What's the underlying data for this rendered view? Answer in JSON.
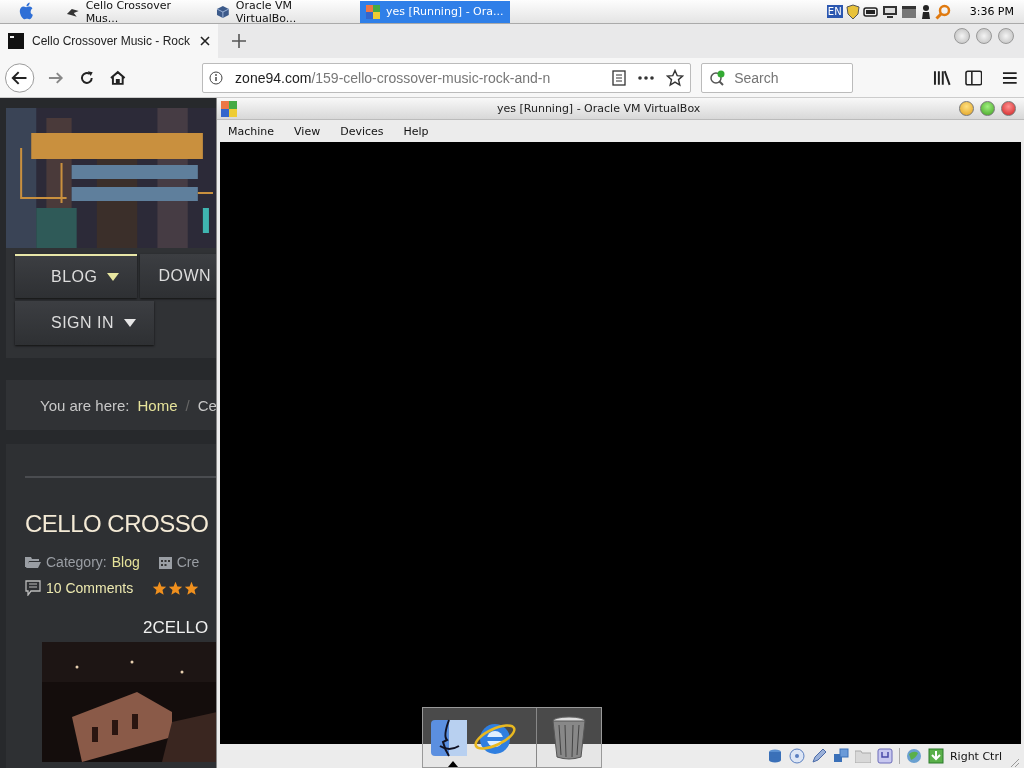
{
  "taskbar": {
    "tasks": [
      {
        "title": "Cello Crossover Mus...",
        "selected": false
      },
      {
        "title": "Oracle VM VirtualBo...",
        "selected": false
      },
      {
        "title": "yes [Running] - Ora...",
        "selected": true
      }
    ],
    "keyboard_layout": "EN",
    "clock": "3:36 PM"
  },
  "browser": {
    "tab": {
      "title": "Cello Crossover Music - Rock"
    },
    "address": {
      "domain": "zone94.com",
      "path": "/159-cello-crossover-music-rock-and-n"
    },
    "search": {
      "placeholder": "Search"
    }
  },
  "page": {
    "nav": [
      {
        "label": "BLOG",
        "selected": true,
        "has_menu": true
      },
      {
        "label": "DOWN",
        "selected": false,
        "has_menu": false
      },
      {
        "label": "SIGN IN",
        "selected": false,
        "has_menu": true
      }
    ],
    "breadcrumb": {
      "label": "You are here:",
      "items": [
        "Home",
        "Ce"
      ],
      "separator": "/"
    },
    "article": {
      "title": "CELLO CROSSO",
      "category_label": "Category:",
      "category": "Blog",
      "created": "Cre",
      "comments": "10 Comments",
      "stars": 3,
      "heading": "2CELLO"
    }
  },
  "vbox": {
    "title": "yes [Running] - Oracle VM VirtualBox",
    "menu": [
      "Machine",
      "View",
      "Devices",
      "Help"
    ],
    "host_key": "Right Ctrl"
  }
}
